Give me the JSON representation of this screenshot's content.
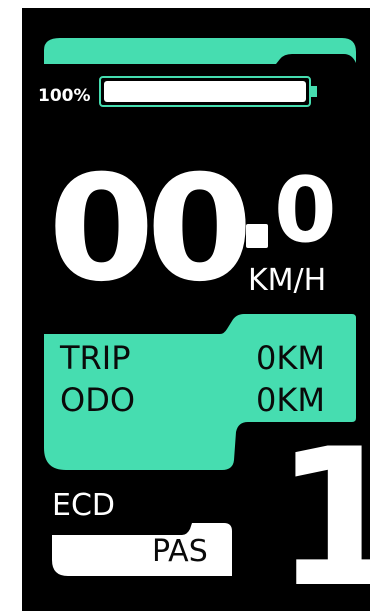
{
  "colors": {
    "accent": "#46DDB0",
    "background": "#000000",
    "foreground": "#FFFFFF"
  },
  "battery": {
    "level_text": "100%",
    "level": 1.0
  },
  "speed": {
    "integer": "00",
    "decimal": "0",
    "unit": "KM/H"
  },
  "trip": {
    "label": "TRIP",
    "value": "0KM"
  },
  "odo": {
    "label": "ODO",
    "value": "0KM"
  },
  "mode": {
    "label": "ECD"
  },
  "pas": {
    "label": "PAS",
    "level": "1"
  }
}
